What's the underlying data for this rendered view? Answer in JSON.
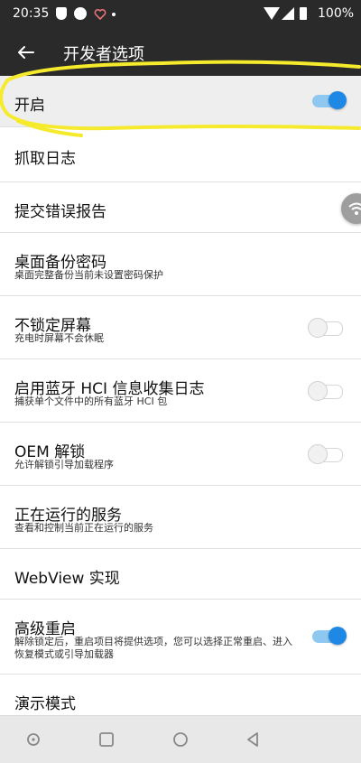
{
  "status_bar": {
    "time": "20:35",
    "battery": "100%"
  },
  "app_bar": {
    "title": "开发者选项"
  },
  "rows": [
    {
      "title": "开启"
    },
    {
      "title": "抓取日志"
    },
    {
      "title": "提交错误报告"
    },
    {
      "title": "桌面备份密码",
      "subtitle": "桌面完整备份当前未设置密码保护"
    },
    {
      "title": "不锁定屏幕",
      "subtitle": "充电时屏幕不会休眠"
    },
    {
      "title": "启用蓝牙 HCI 信息收集日志",
      "subtitle": "捕获单个文件中的所有蓝牙 HCI 包"
    },
    {
      "title": "OEM 解锁",
      "subtitle": "允许解锁引导加载程序"
    },
    {
      "title": "正在运行的服务",
      "subtitle": "查看和控制当前正在运行的服务"
    },
    {
      "title": "WebView 实现"
    },
    {
      "title": "高级重启",
      "subtitle": "解除锁定后，重启项目将提供选项，您可以选择正常重启、进入恢复模式或引导加载器"
    },
    {
      "title": "演示模式"
    }
  ],
  "toggles": {
    "enable": true,
    "stay_awake": false,
    "bt_hci_log": false,
    "oem_unlock": false,
    "advanced_reboot": true
  },
  "colors": {
    "accent": "#1e88e5",
    "header": "#2a2a2a",
    "annotation": "#f5ea2c"
  }
}
